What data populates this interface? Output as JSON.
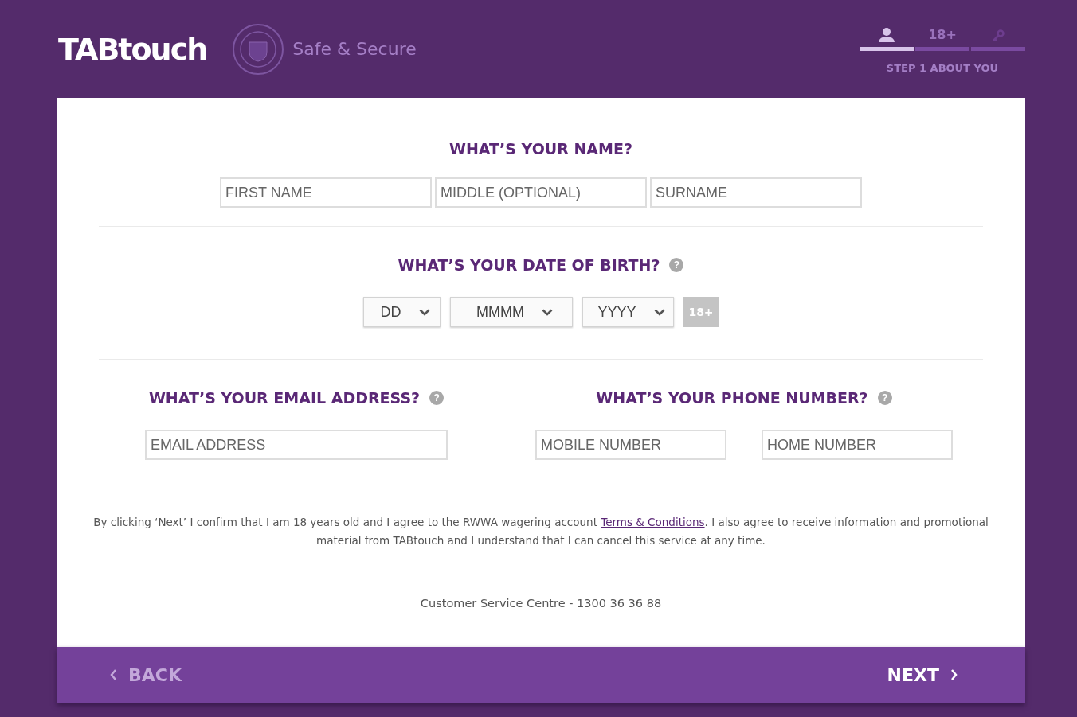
{
  "header": {
    "logo": "TABtouch",
    "tagline": "Safe & Secure"
  },
  "steps": [
    {
      "kind": "person",
      "selected": true
    },
    {
      "kind": "age",
      "label": "18+",
      "selected": false
    },
    {
      "kind": "key",
      "selected": false
    }
  ],
  "step_caption": "STEP 1 ABOUT YOU",
  "name_section": {
    "heading": "WHAT’S YOUR NAME?",
    "fields": [
      {
        "placeholder": "FIRST NAME"
      },
      {
        "placeholder": "MIDDLE (OPTIONAL)"
      },
      {
        "placeholder": "SURNAME"
      }
    ]
  },
  "dob_section": {
    "heading": "WHAT’S YOUR DATE OF BIRTH?",
    "help": "?",
    "selects": [
      {
        "value": "DD"
      },
      {
        "value": "MMMM"
      },
      {
        "value": "YYYY"
      }
    ],
    "age_badge": {
      "label": "18+",
      "active": false
    }
  },
  "email_section": {
    "heading": "WHAT’S YOUR EMAIL ADDRESS?",
    "help": "?",
    "fields": [
      {
        "placeholder": "EMAIL ADDRESS"
      }
    ]
  },
  "phone_section": {
    "heading": "WHAT’S YOUR PHONE NUMBER?",
    "help": "?",
    "fields": [
      {
        "placeholder": "MOBILE NUMBER"
      },
      {
        "placeholder": "HOME NUMBER"
      }
    ]
  },
  "terms": {
    "before": "By clicking ‘Next’ I confirm that I am 18 years old and I agree to the RWWA wagering account",
    "link": "Terms & Conditions",
    "after": ". I also agree to receive information and promotional material from TABtouch and I understand that I can cancel this service at any time."
  },
  "contact": "Customer Service Centre - 1300 36 36 88",
  "footer": {
    "back": "BACK",
    "next": "NEXT"
  }
}
